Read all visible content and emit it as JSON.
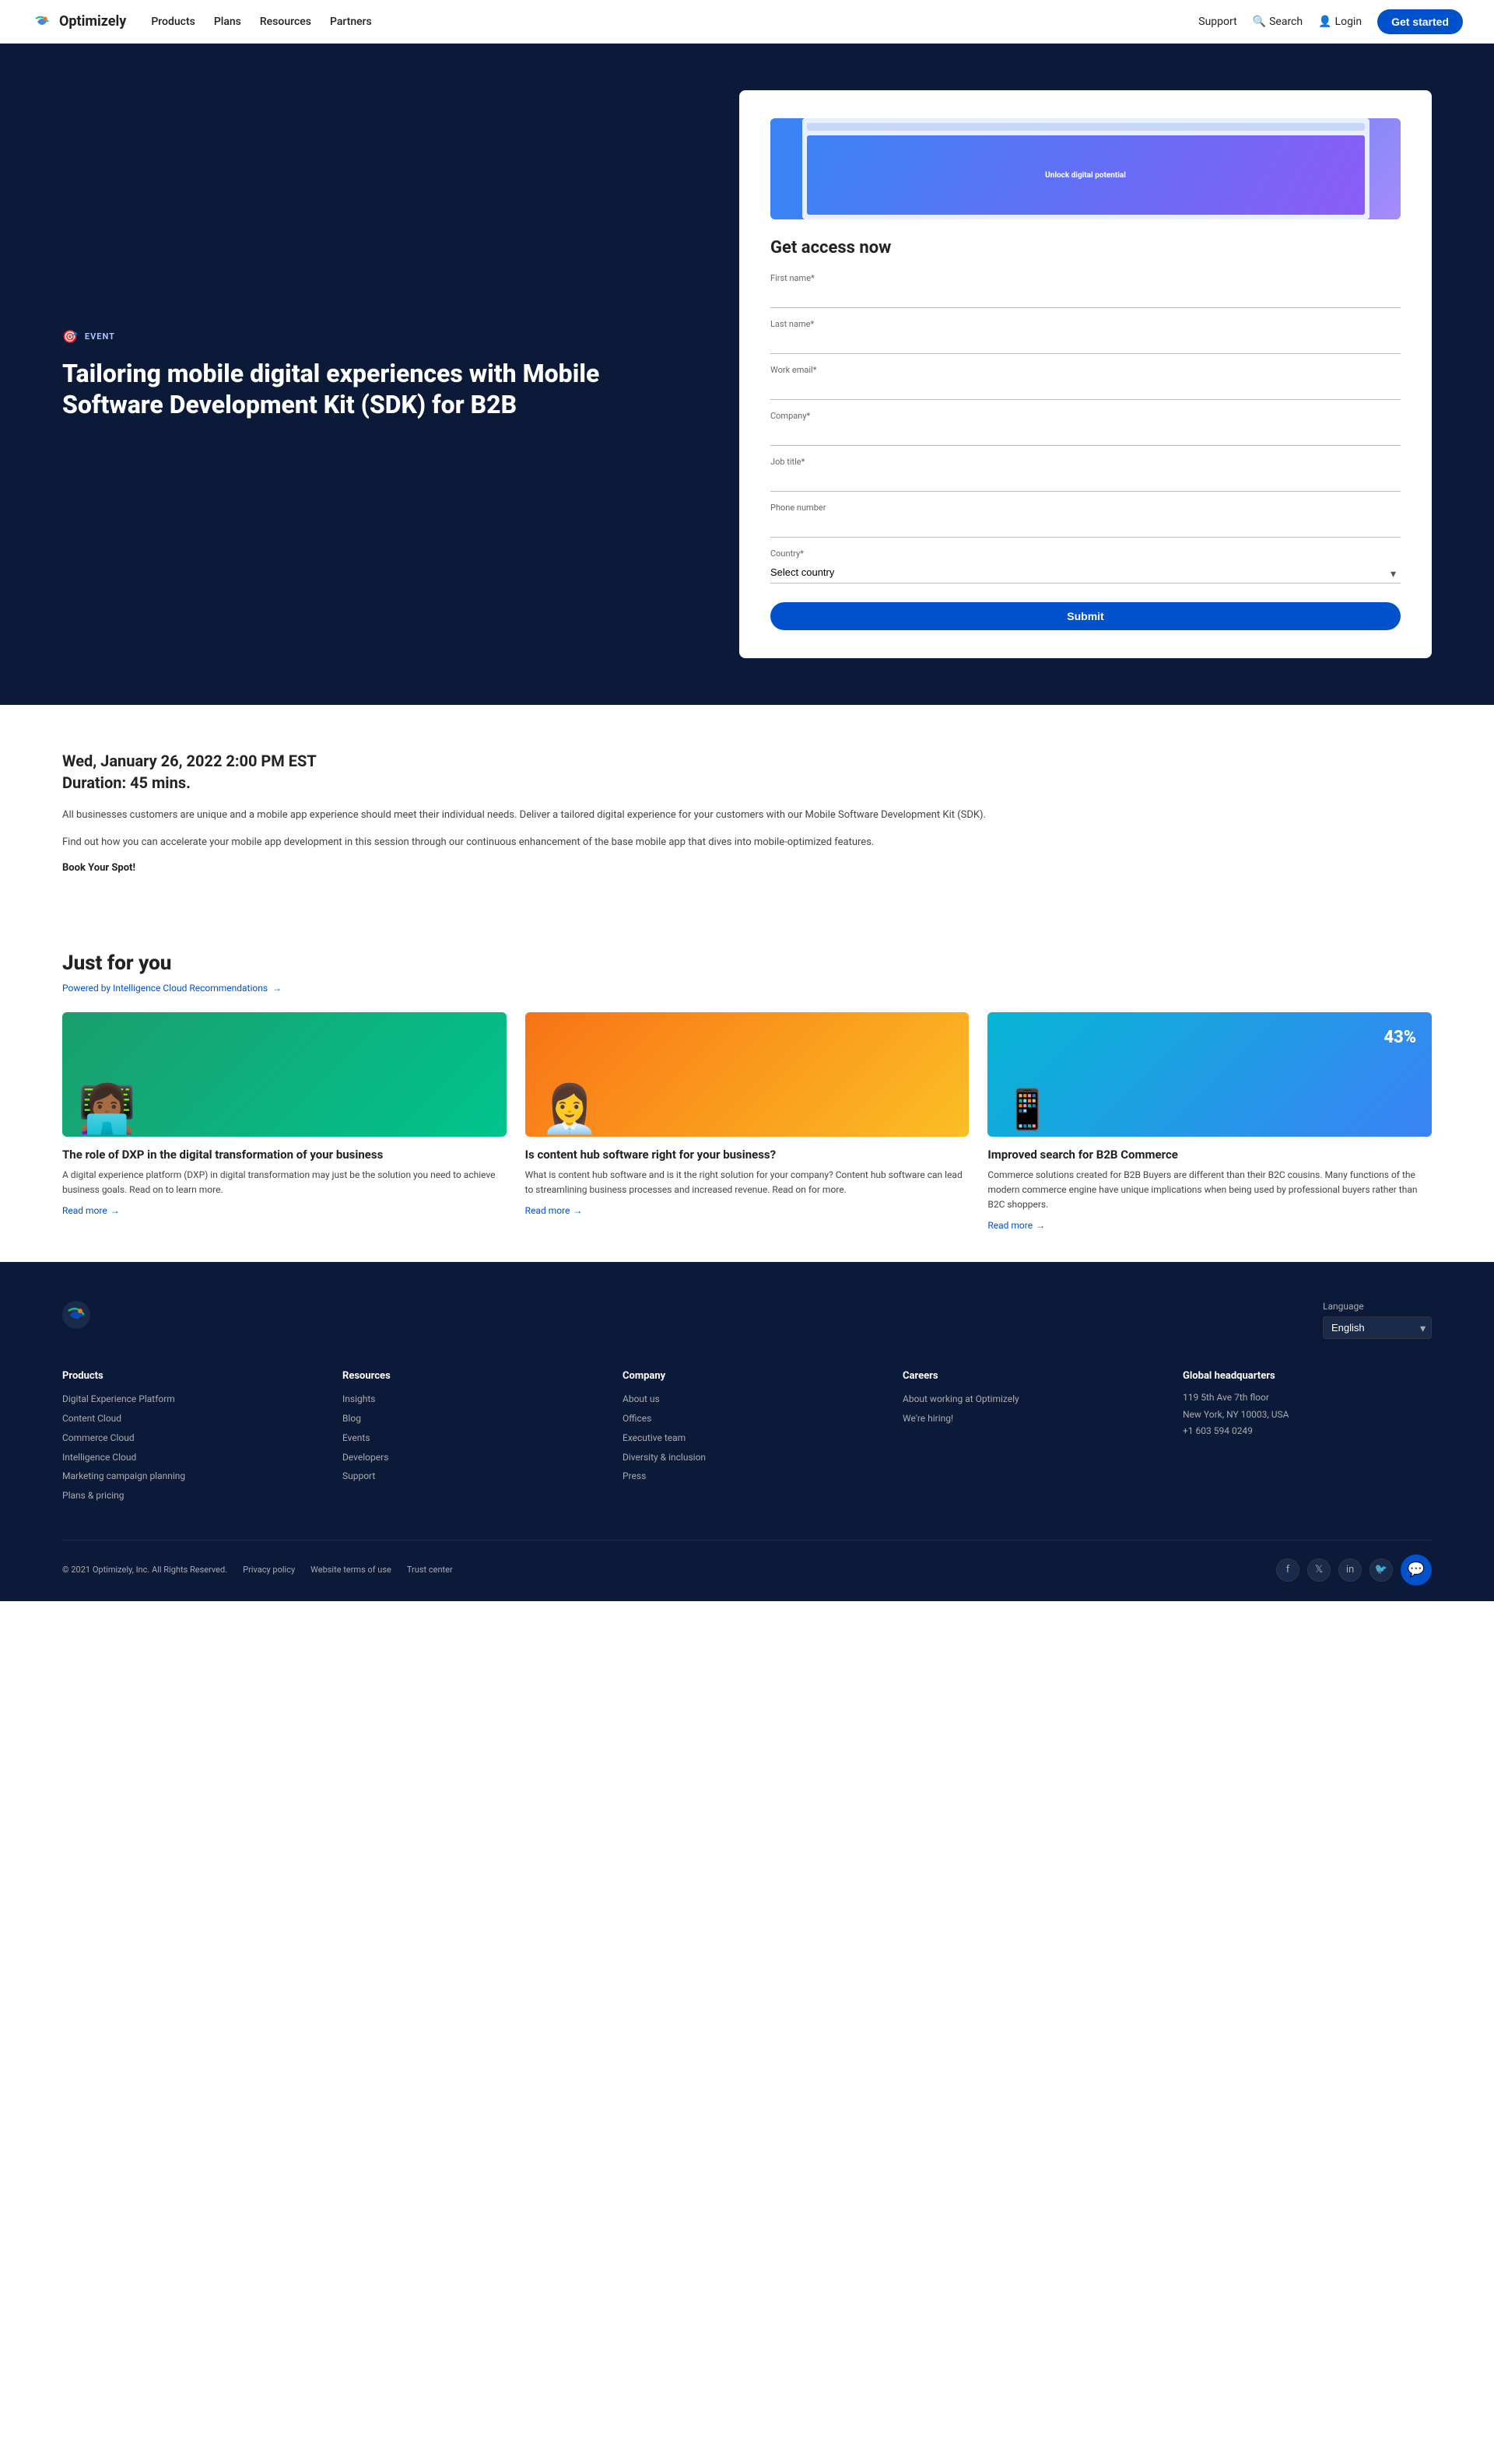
{
  "navbar": {
    "logo_text": "Optimizely",
    "links": [
      "Products",
      "Plans",
      "Resources",
      "Partners"
    ],
    "right_links": [
      "Support",
      "Search",
      "Login"
    ],
    "cta": "Get started"
  },
  "hero": {
    "event_tag": "EVENT",
    "title": "Tailoring mobile digital experiences with Mobile Software Development Kit (SDK) for B2B",
    "preview_text": "Unlock digital potential",
    "form": {
      "heading": "Get access now",
      "fields": [
        {
          "label": "First name*",
          "type": "text",
          "placeholder": ""
        },
        {
          "label": "Last name*",
          "type": "text",
          "placeholder": ""
        },
        {
          "label": "Work email*",
          "type": "email",
          "placeholder": ""
        },
        {
          "label": "Company*",
          "type": "text",
          "placeholder": ""
        },
        {
          "label": "Job title*",
          "type": "text",
          "placeholder": ""
        },
        {
          "label": "Phone number",
          "type": "tel",
          "placeholder": ""
        }
      ],
      "country_label": "Country*",
      "country_placeholder": "Select country",
      "submit_label": "Submit"
    }
  },
  "event_info": {
    "date": "Wed, January 26, 2022 2:00 PM EST",
    "duration": "Duration: 45 mins.",
    "description1": "All businesses customers are unique and a mobile app experience should meet their individual needs. Deliver a tailored digital experience for your customers with our Mobile Software Development Kit (SDK).",
    "description2": "Find out how you can accelerate your mobile app development in this session through our continuous enhancement of the base mobile app that dives into mobile-optimized features.",
    "book_text": "Book Your Spot!"
  },
  "just_for_you": {
    "heading": "Just for you",
    "powered_by": "Powered by Intelligence Cloud Recommendations",
    "cards": [
      {
        "title": "The role of DXP in the digital transformation of your business",
        "description": "A digital experience platform (DXP) in digital transformation may just be the solution you need to achieve business goals. Read on to learn more.",
        "read_more": "Read more",
        "color": "green"
      },
      {
        "title": "Is content hub software right for your business?",
        "description": "What is content hub software and is it the right solution for your company? Content hub software can lead to streamlining business processes and increased revenue. Read on for more.",
        "read_more": "Read more",
        "color": "orange"
      },
      {
        "title": "Improved search for B2B Commerce",
        "description": "Commerce solutions created for B2B Buyers are different than their B2C cousins. Many functions of the modern commerce engine have unique implications when being used by professional buyers rather than B2C shoppers.",
        "read_more": "Read more",
        "color": "blue"
      }
    ]
  },
  "footer": {
    "language_label": "Language",
    "language_value": "English",
    "columns": {
      "products": {
        "heading": "Products",
        "links": [
          "Digital Experience Platform",
          "Content Cloud",
          "Commerce Cloud",
          "Intelligence Cloud",
          "Marketing campaign planning",
          "Plans & pricing"
        ]
      },
      "resources": {
        "heading": "Resources",
        "links": [
          "Insights",
          "Blog",
          "Events",
          "Developers",
          "Support"
        ]
      },
      "company": {
        "heading": "Company",
        "links": [
          "About us",
          "Offices",
          "Executive team",
          "Diversity & inclusion",
          "Press"
        ]
      },
      "careers": {
        "heading": "Careers",
        "links": [
          "About working at Optimizely",
          "We're hiring!"
        ]
      },
      "hq": {
        "heading": "Global headquarters",
        "address": "119 5th Ave 7th floor",
        "city": "New York, NY 10003, USA",
        "phone": "+1 603 594 0249"
      }
    },
    "bottom": {
      "copyright": "© 2021 Optimizely, Inc. All Rights Reserved.",
      "links": [
        "Privacy policy",
        "Website terms of use",
        "Trust center"
      ]
    },
    "social": [
      "f",
      "in",
      "in",
      "t"
    ]
  }
}
